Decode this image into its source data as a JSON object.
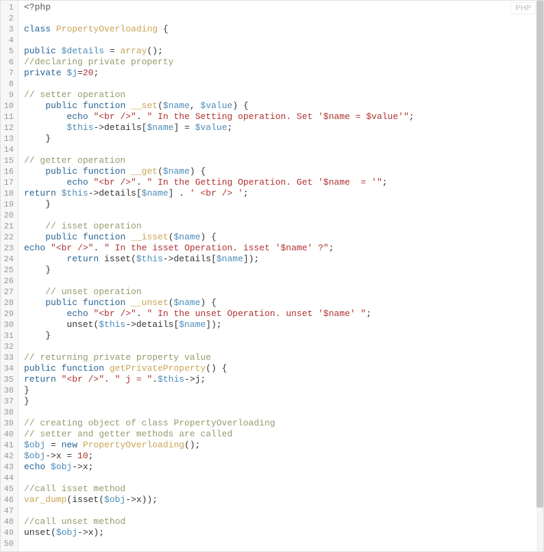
{
  "language_badge": "PHP",
  "code": {
    "lines": [
      [
        {
          "t": "php",
          "s": "<?php"
        }
      ],
      [],
      [
        {
          "t": "kw",
          "s": "class"
        },
        {
          "t": "",
          "s": " "
        },
        {
          "t": "fn",
          "s": "PropertyOverloading"
        },
        {
          "t": "",
          "s": " {"
        }
      ],
      [],
      [
        {
          "t": "kw",
          "s": "public"
        },
        {
          "t": "",
          "s": " "
        },
        {
          "t": "var",
          "s": "$details"
        },
        {
          "t": "",
          "s": " = "
        },
        {
          "t": "fn",
          "s": "array"
        },
        {
          "t": "",
          "s": "();"
        }
      ],
      [
        {
          "t": "com",
          "s": "//declaring private property"
        }
      ],
      [
        {
          "t": "kw",
          "s": "private"
        },
        {
          "t": "",
          "s": " "
        },
        {
          "t": "var",
          "s": "$j"
        },
        {
          "t": "",
          "s": "="
        },
        {
          "t": "num",
          "s": "20"
        },
        {
          "t": "",
          "s": ";"
        }
      ],
      [],
      [
        {
          "t": "com",
          "s": "// setter operation"
        }
      ],
      [
        {
          "t": "",
          "s": "    "
        },
        {
          "t": "kw",
          "s": "public"
        },
        {
          "t": "",
          "s": " "
        },
        {
          "t": "kw",
          "s": "function"
        },
        {
          "t": "",
          "s": " "
        },
        {
          "t": "fn",
          "s": "__set"
        },
        {
          "t": "",
          "s": "("
        },
        {
          "t": "var",
          "s": "$name"
        },
        {
          "t": "",
          "s": ", "
        },
        {
          "t": "var",
          "s": "$value"
        },
        {
          "t": "",
          "s": ") {"
        }
      ],
      [
        {
          "t": "",
          "s": "        "
        },
        {
          "t": "kw",
          "s": "echo"
        },
        {
          "t": "",
          "s": " "
        },
        {
          "t": "str",
          "s": "\"<br />\""
        },
        {
          "t": "",
          "s": ". "
        },
        {
          "t": "str",
          "s": "\" In the Setting operation. Set '$name = $value'\""
        },
        {
          "t": "",
          "s": ";"
        }
      ],
      [
        {
          "t": "",
          "s": "        "
        },
        {
          "t": "var",
          "s": "$this"
        },
        {
          "t": "",
          "s": "->details["
        },
        {
          "t": "var",
          "s": "$name"
        },
        {
          "t": "",
          "s": "] = "
        },
        {
          "t": "var",
          "s": "$value"
        },
        {
          "t": "",
          "s": ";"
        }
      ],
      [
        {
          "t": "",
          "s": "    }"
        }
      ],
      [],
      [
        {
          "t": "com",
          "s": "// getter operation"
        }
      ],
      [
        {
          "t": "",
          "s": "    "
        },
        {
          "t": "kw",
          "s": "public"
        },
        {
          "t": "",
          "s": " "
        },
        {
          "t": "kw",
          "s": "function"
        },
        {
          "t": "",
          "s": " "
        },
        {
          "t": "fn",
          "s": "__get"
        },
        {
          "t": "",
          "s": "("
        },
        {
          "t": "var",
          "s": "$name"
        },
        {
          "t": "",
          "s": ") {"
        }
      ],
      [
        {
          "t": "",
          "s": "        "
        },
        {
          "t": "kw",
          "s": "echo"
        },
        {
          "t": "",
          "s": " "
        },
        {
          "t": "str",
          "s": "\"<br />\""
        },
        {
          "t": "",
          "s": ". "
        },
        {
          "t": "str",
          "s": "\" In the Getting Operation. Get '$name  = '\""
        },
        {
          "t": "",
          "s": ";"
        }
      ],
      [
        {
          "t": "kw",
          "s": "return"
        },
        {
          "t": "",
          "s": " "
        },
        {
          "t": "var",
          "s": "$this"
        },
        {
          "t": "",
          "s": "->details["
        },
        {
          "t": "var",
          "s": "$name"
        },
        {
          "t": "",
          "s": "] . "
        },
        {
          "t": "str",
          "s": "' <br /> '"
        },
        {
          "t": "",
          "s": ";"
        }
      ],
      [
        {
          "t": "",
          "s": "    }"
        }
      ],
      [],
      [
        {
          "t": "",
          "s": "    "
        },
        {
          "t": "com",
          "s": "// isset operation"
        }
      ],
      [
        {
          "t": "",
          "s": "    "
        },
        {
          "t": "kw",
          "s": "public"
        },
        {
          "t": "",
          "s": " "
        },
        {
          "t": "kw",
          "s": "function"
        },
        {
          "t": "",
          "s": " "
        },
        {
          "t": "fn",
          "s": "__isset"
        },
        {
          "t": "",
          "s": "("
        },
        {
          "t": "var",
          "s": "$name"
        },
        {
          "t": "",
          "s": ") {"
        }
      ],
      [
        {
          "t": "kw",
          "s": "echo"
        },
        {
          "t": "",
          "s": " "
        },
        {
          "t": "str",
          "s": "\"<br />\""
        },
        {
          "t": "",
          "s": ". "
        },
        {
          "t": "str",
          "s": "\" In the isset Operation. isset '$name' ?\""
        },
        {
          "t": "",
          "s": ";"
        }
      ],
      [
        {
          "t": "",
          "s": "        "
        },
        {
          "t": "kw",
          "s": "return"
        },
        {
          "t": "",
          "s": " isset("
        },
        {
          "t": "var",
          "s": "$this"
        },
        {
          "t": "",
          "s": "->details["
        },
        {
          "t": "var",
          "s": "$name"
        },
        {
          "t": "",
          "s": "]);"
        }
      ],
      [
        {
          "t": "",
          "s": "    }"
        }
      ],
      [],
      [
        {
          "t": "",
          "s": "    "
        },
        {
          "t": "com",
          "s": "// unset operation"
        }
      ],
      [
        {
          "t": "",
          "s": "    "
        },
        {
          "t": "kw",
          "s": "public"
        },
        {
          "t": "",
          "s": " "
        },
        {
          "t": "kw",
          "s": "function"
        },
        {
          "t": "",
          "s": " "
        },
        {
          "t": "fn",
          "s": "__unset"
        },
        {
          "t": "",
          "s": "("
        },
        {
          "t": "var",
          "s": "$name"
        },
        {
          "t": "",
          "s": ") {"
        }
      ],
      [
        {
          "t": "",
          "s": "        "
        },
        {
          "t": "kw",
          "s": "echo"
        },
        {
          "t": "",
          "s": " "
        },
        {
          "t": "str",
          "s": "\"<br />\""
        },
        {
          "t": "",
          "s": ". "
        },
        {
          "t": "str",
          "s": "\" In the unset Operation. unset '$name' \""
        },
        {
          "t": "",
          "s": ";"
        }
      ],
      [
        {
          "t": "",
          "s": "        unset("
        },
        {
          "t": "var",
          "s": "$this"
        },
        {
          "t": "",
          "s": "->details["
        },
        {
          "t": "var",
          "s": "$name"
        },
        {
          "t": "",
          "s": "]);"
        }
      ],
      [
        {
          "t": "",
          "s": "    }"
        }
      ],
      [],
      [
        {
          "t": "com",
          "s": "// returning private property value"
        }
      ],
      [
        {
          "t": "kw",
          "s": "public"
        },
        {
          "t": "",
          "s": " "
        },
        {
          "t": "kw",
          "s": "function"
        },
        {
          "t": "",
          "s": " "
        },
        {
          "t": "fn",
          "s": "getPrivateProperty"
        },
        {
          "t": "",
          "s": "() {"
        }
      ],
      [
        {
          "t": "kw",
          "s": "return"
        },
        {
          "t": "",
          "s": " "
        },
        {
          "t": "str",
          "s": "\"<br />\""
        },
        {
          "t": "",
          "s": ". "
        },
        {
          "t": "str",
          "s": "\" j = \""
        },
        {
          "t": "",
          "s": "."
        },
        {
          "t": "var",
          "s": "$this"
        },
        {
          "t": "",
          "s": "->j;"
        }
      ],
      [
        {
          "t": "",
          "s": "}"
        }
      ],
      [
        {
          "t": "",
          "s": "}"
        }
      ],
      [],
      [
        {
          "t": "com",
          "s": "// creating object of class PropertyOverloading"
        }
      ],
      [
        {
          "t": "com",
          "s": "// setter and getter methods are called"
        }
      ],
      [
        {
          "t": "var",
          "s": "$obj"
        },
        {
          "t": "",
          "s": " = "
        },
        {
          "t": "kw",
          "s": "new"
        },
        {
          "t": "",
          "s": " "
        },
        {
          "t": "fn",
          "s": "PropertyOverloading"
        },
        {
          "t": "",
          "s": "();"
        }
      ],
      [
        {
          "t": "var",
          "s": "$obj"
        },
        {
          "t": "",
          "s": "->x = "
        },
        {
          "t": "num",
          "s": "10"
        },
        {
          "t": "",
          "s": ";"
        }
      ],
      [
        {
          "t": "kw",
          "s": "echo"
        },
        {
          "t": "",
          "s": " "
        },
        {
          "t": "var",
          "s": "$obj"
        },
        {
          "t": "",
          "s": "->x;"
        }
      ],
      [],
      [
        {
          "t": "com",
          "s": "//call isset method"
        }
      ],
      [
        {
          "t": "fn",
          "s": "var_dump"
        },
        {
          "t": "",
          "s": "(isset("
        },
        {
          "t": "var",
          "s": "$obj"
        },
        {
          "t": "",
          "s": "->x));"
        }
      ],
      [],
      [
        {
          "t": "com",
          "s": "//call unset method"
        }
      ],
      [
        {
          "t": "",
          "s": "unset("
        },
        {
          "t": "var",
          "s": "$obj"
        },
        {
          "t": "",
          "s": "->x);"
        }
      ],
      []
    ]
  }
}
